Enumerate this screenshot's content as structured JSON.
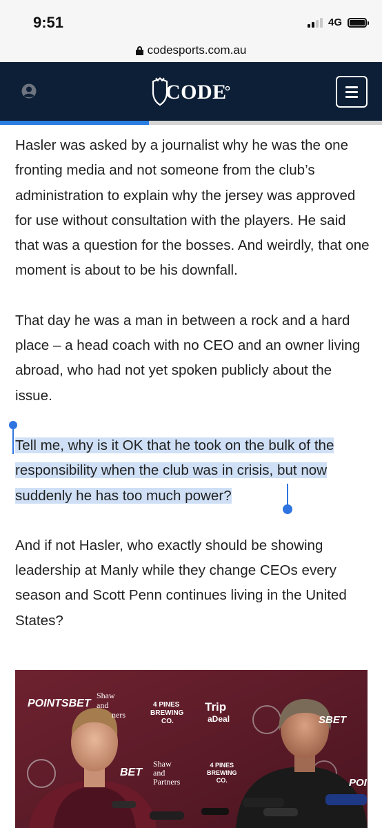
{
  "status_bar": {
    "time": "9:51",
    "network": "4G",
    "icons": [
      "signal-icon",
      "battery-icon"
    ]
  },
  "browser": {
    "url": "codesports.com.au",
    "icons": [
      "lock-icon"
    ]
  },
  "header": {
    "logo_text": "CODE",
    "icons": [
      "user-icon",
      "menu-icon"
    ],
    "colors": {
      "background": "#0d1f36",
      "accent": "#2a7de1"
    }
  },
  "reading_progress": 0.39,
  "article": {
    "paragraphs": [
      "Hasler was asked by a journalist why he was the one fronting media and not someone from the club’s administration to explain why the jersey was approved for use without consultation with the players. He said that was a question for the bosses. And weirdly, that one moment is about to be his downfall.",
      "That day he was a man in between a rock and a hard place – a head coach with no CEO and an owner living abroad, who had not yet spoken publicly about the issue.",
      "Tell me, why is it OK that he took on the bulk of the responsibility when the club was in crisis, but now suddenly he has too much power?",
      "And if not Hasler, who exactly should be showing leadership at Manly while they change CEOs every season and Scott Penn continues living in the United States?"
    ],
    "selection_color": "#cfe0f6",
    "photo": {
      "backdrop_text": {
        "pointsbet": "POINTSBET",
        "shaw": "Shaw",
        "and": "and",
        "partners_fragment": "ners",
        "four_pines_line1": "4 PINES",
        "four_pines_line2": "BREWING",
        "four_pines_line3": "CO.",
        "trip": "Trip",
        "a_deal": "aDeal",
        "sbet": "SBET",
        "bet": "BET",
        "shaw_partners": "Shaw\nand\nPartners",
        "four_pines_lower": "4 PINES\nBREWING\nCO.",
        "poi": "POI"
      }
    }
  }
}
